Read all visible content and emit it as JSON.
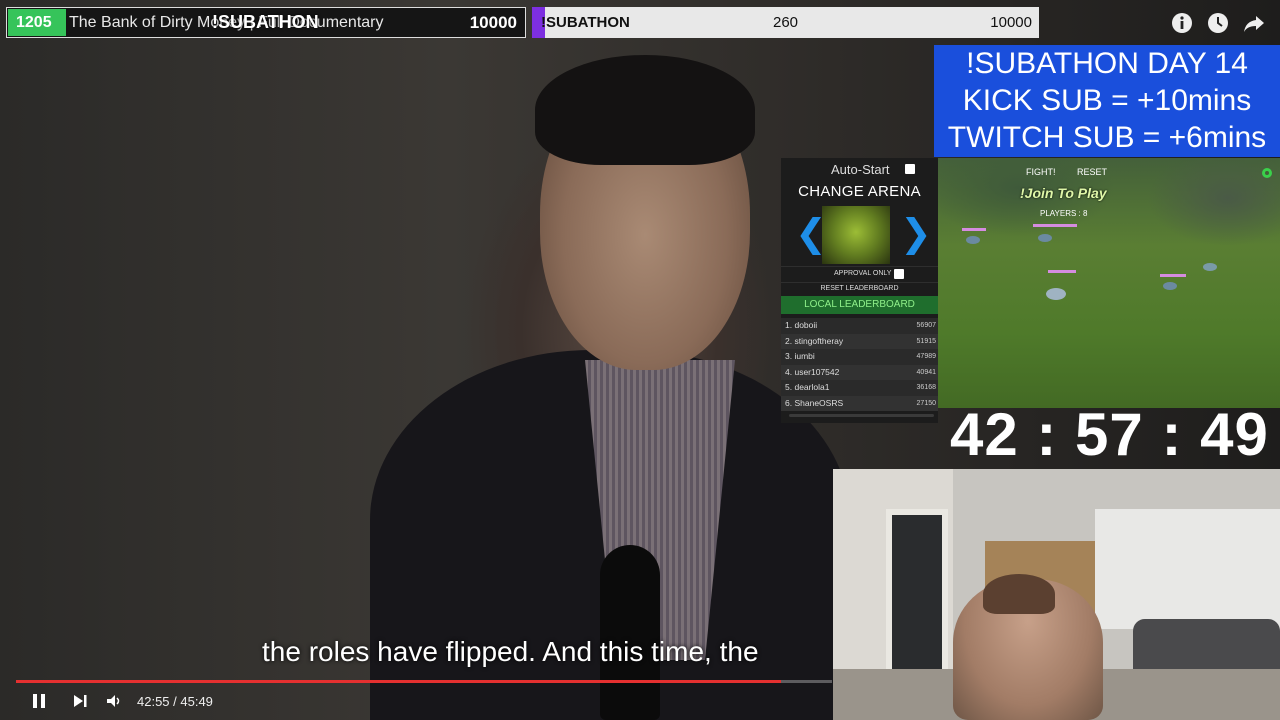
{
  "top_bar_left": {
    "count": "1205",
    "title": "The Bank of Dirty Money | Full Documentary",
    "label": "!SUBATHON",
    "goal": "10000"
  },
  "top_bar_right": {
    "label": "!SUBATHON",
    "count": "260",
    "goal": "10000",
    "progress_fraction": 0.026
  },
  "top_icons": [
    "info-icon",
    "clock-icon",
    "share-icon"
  ],
  "banner": {
    "line1": "!SUBATHON DAY 14",
    "line2": "KICK SUB = +10mins",
    "line3": "TWITCH SUB = +6mins"
  },
  "arena": {
    "auto_start_label": "Auto-Start",
    "change_arena_label": "CHANGE ARENA",
    "approval_only_label": "APPROVAL ONLY",
    "reset_leaderboard_label": "RESET LEADERBOARD",
    "local_leaderboard_label": "LOCAL LEADERBOARD",
    "leaderboard": [
      {
        "rank": "1.",
        "name": "doboii",
        "score": "56907"
      },
      {
        "rank": "2.",
        "name": "stingoftheray",
        "score": "51915"
      },
      {
        "rank": "3.",
        "name": "iumbi",
        "score": "47989"
      },
      {
        "rank": "4.",
        "name": "user107542",
        "score": "40941"
      },
      {
        "rank": "5.",
        "name": "dearlola1",
        "score": "36168"
      },
      {
        "rank": "6.",
        "name": "ShaneOSRS",
        "score": "27150"
      }
    ]
  },
  "game": {
    "fight_label": "FIGHT!",
    "reset_label": "RESET",
    "join_label": "!Join To Play",
    "players_label": "PLAYERS : 8"
  },
  "timer": "42 : 57 : 49",
  "subtitle": "the roles have flipped. And this time, the",
  "player": {
    "time": "42:55 / 45:49",
    "progress_fraction": 0.937
  },
  "colors": {
    "green": "#36c45a",
    "purple": "#7d2fe0",
    "banner_blue": "#1a4fdc",
    "progress_red": "#e53030",
    "arrow_blue": "#1e8ee8"
  }
}
